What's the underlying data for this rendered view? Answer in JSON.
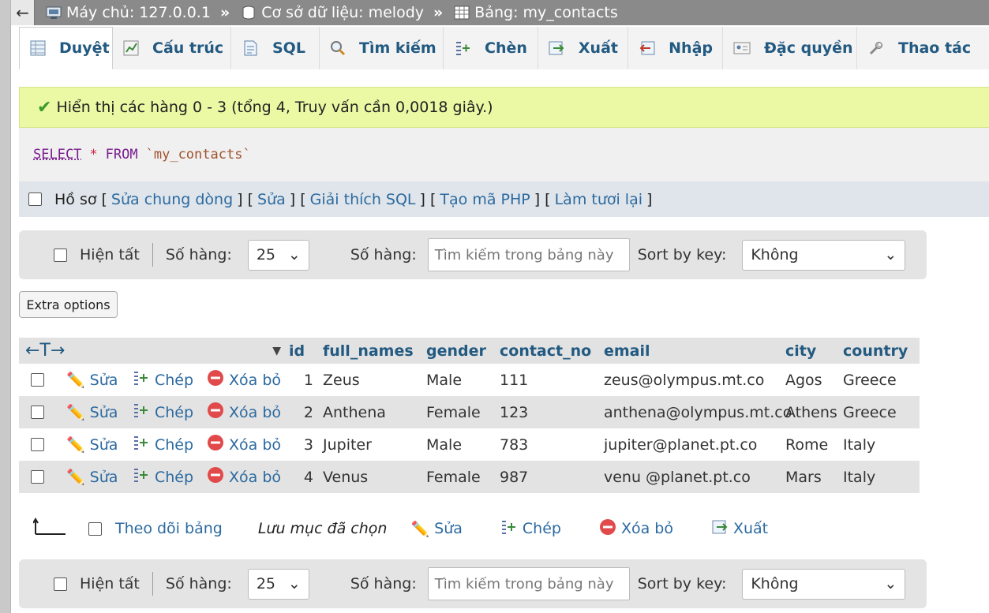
{
  "breadcrumb": {
    "back": "←",
    "server": "Máy chủ: 127.0.0.1",
    "database": "Cơ sở dữ liệu: melody",
    "table": "Bảng: my_contacts",
    "separator": "»"
  },
  "tabs": [
    {
      "label": "Duyệt",
      "icon": "browse-icon"
    },
    {
      "label": "Cấu trúc",
      "icon": "structure-icon"
    },
    {
      "label": "SQL",
      "icon": "sql-icon"
    },
    {
      "label": "Tìm kiếm",
      "icon": "search-icon"
    },
    {
      "label": "Chèn",
      "icon": "insert-icon"
    },
    {
      "label": "Xuất",
      "icon": "export-icon"
    },
    {
      "label": "Nhập",
      "icon": "import-icon"
    },
    {
      "label": "Đặc quyền",
      "icon": "privileges-icon"
    },
    {
      "label": "Thao tác",
      "icon": "operations-icon"
    }
  ],
  "message": {
    "text": "Hiển thị các hàng 0 - 3 (tổng 4, Truy vấn cần 0,0018 giây.)"
  },
  "query": {
    "select": "SELECT",
    "star": "*",
    "from": "FROM",
    "table": "`my_contacts`"
  },
  "profile": {
    "label": "Hồ sơ",
    "links": [
      "Sửa chung dòng",
      "Sửa",
      "Giải thích SQL",
      "Tạo mã PHP",
      "Làm tươi lại"
    ]
  },
  "nav": {
    "show_all": "Hiện tất",
    "rows_label": "Số hàng:",
    "rows_value": "25",
    "filter_label": "Số hàng:",
    "filter_placeholder": "Tìm kiếm trong bảng này",
    "sort_label": "Sort by key:",
    "sort_value": "Không"
  },
  "extra_options": "Extra options",
  "table": {
    "columns": [
      "id",
      "full_names",
      "gender",
      "contact_no",
      "email",
      "city",
      "country"
    ],
    "actions": {
      "edit": "Sửa",
      "copy": "Chép",
      "delete": "Xóa bỏ"
    },
    "rows": [
      {
        "id": "1",
        "full_names": "Zeus",
        "gender": "Male",
        "contact_no": "111",
        "email": "zeus@olympus.mt.co",
        "city": "Agos",
        "country": "Greece"
      },
      {
        "id": "2",
        "full_names": "Anthena",
        "gender": "Female",
        "contact_no": "123",
        "email": "anthena@olympus.mt.co",
        "city": "Athens",
        "country": "Greece"
      },
      {
        "id": "3",
        "full_names": "Jupiter",
        "gender": "Male",
        "contact_no": "783",
        "email": "jupiter@planet.pt.co",
        "city": "Rome",
        "country": "Italy"
      },
      {
        "id": "4",
        "full_names": "Venus",
        "gender": "Female",
        "contact_no": "987",
        "email": "venu @planet.pt.co",
        "city": "Mars",
        "country": "Italy"
      }
    ]
  },
  "footer": {
    "check_all": "Theo dõi bảng",
    "with_selected": "Lưu mục đã chọn",
    "edit": "Sửa",
    "copy": "Chép",
    "delete": "Xóa bỏ",
    "export": "Xuất"
  }
}
